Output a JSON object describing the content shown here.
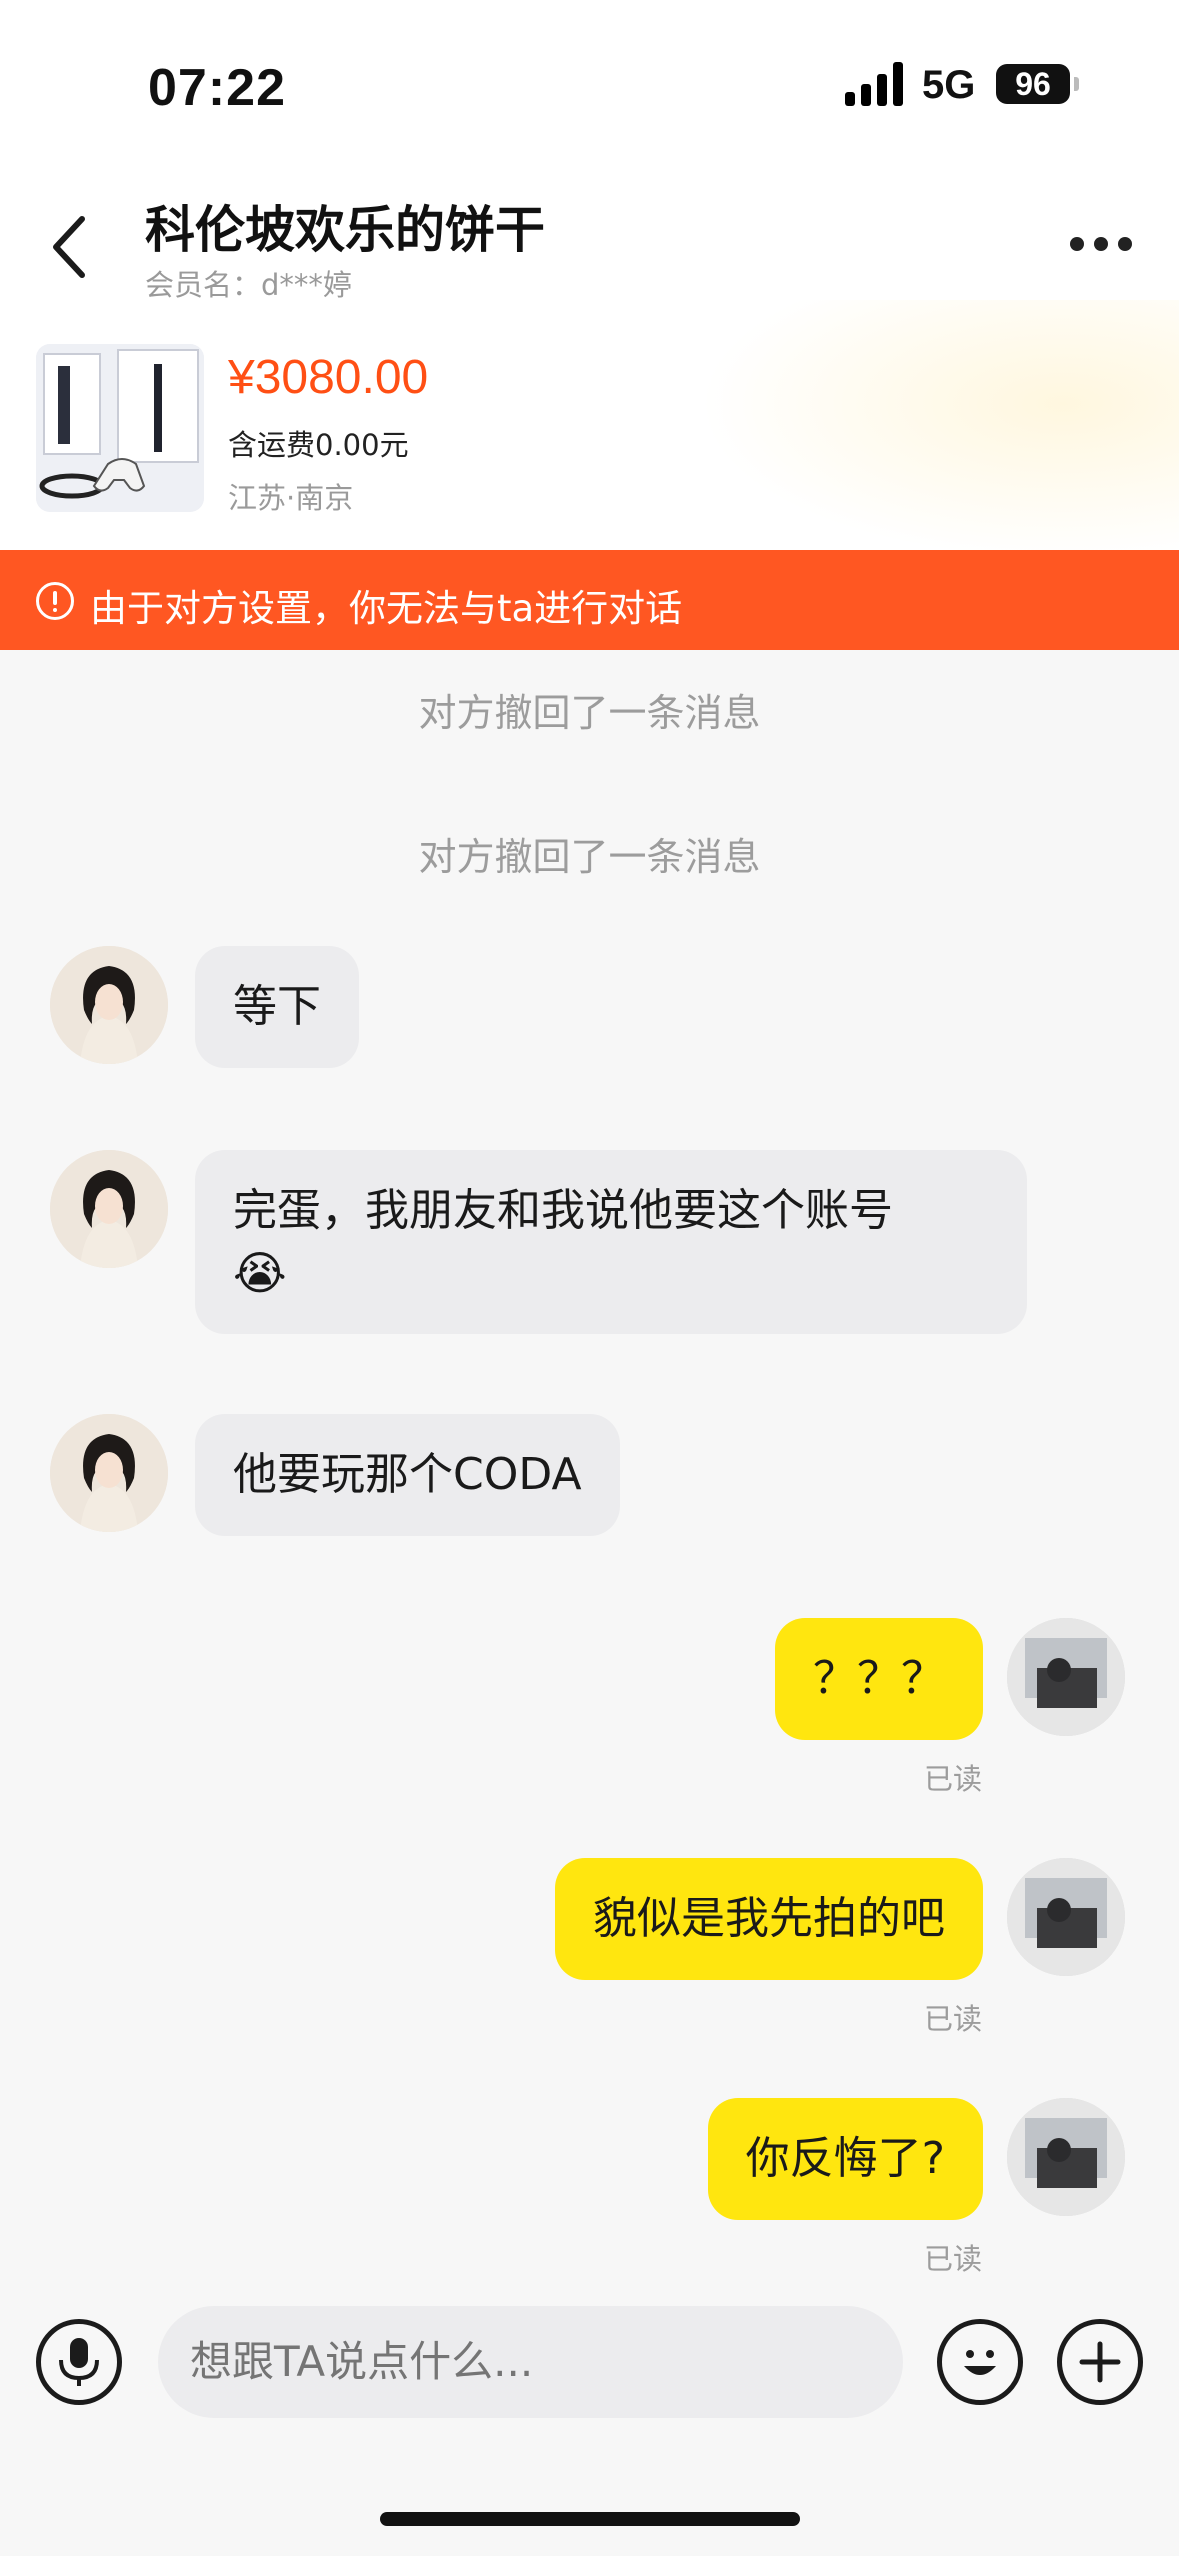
{
  "status_bar": {
    "time": "07:22",
    "network": "5G",
    "battery": "96"
  },
  "header": {
    "title": "科伦坡欢乐的饼干",
    "subtitle": "会员名：d***婷"
  },
  "product": {
    "price": "¥3080.00",
    "shipping": "含运费0.00元",
    "location": "江苏·南京"
  },
  "warning": {
    "text": "由于对方设置，你无法与ta进行对话"
  },
  "notices": [
    "对方撤回了一条消息",
    "对方撤回了一条消息"
  ],
  "messages": [
    {
      "side": "left",
      "text": "等下"
    },
    {
      "side": "left",
      "line1": "完蛋，我朋友和我说他要这个账号",
      "line2": "😭"
    },
    {
      "side": "left",
      "text": "他要玩那个CODA"
    },
    {
      "side": "right",
      "text": "？？？",
      "status": "已读"
    },
    {
      "side": "right",
      "text": "貌似是我先拍的吧",
      "status": "已读"
    },
    {
      "side": "right",
      "text": "你反悔了?",
      "status": "已读"
    }
  ],
  "input": {
    "placeholder": "想跟TA说点什么..."
  },
  "colors": {
    "accent": "#ff5722",
    "price": "#ff4f14",
    "bubble_self": "#ffe60f",
    "bubble_other": "#ececee"
  }
}
